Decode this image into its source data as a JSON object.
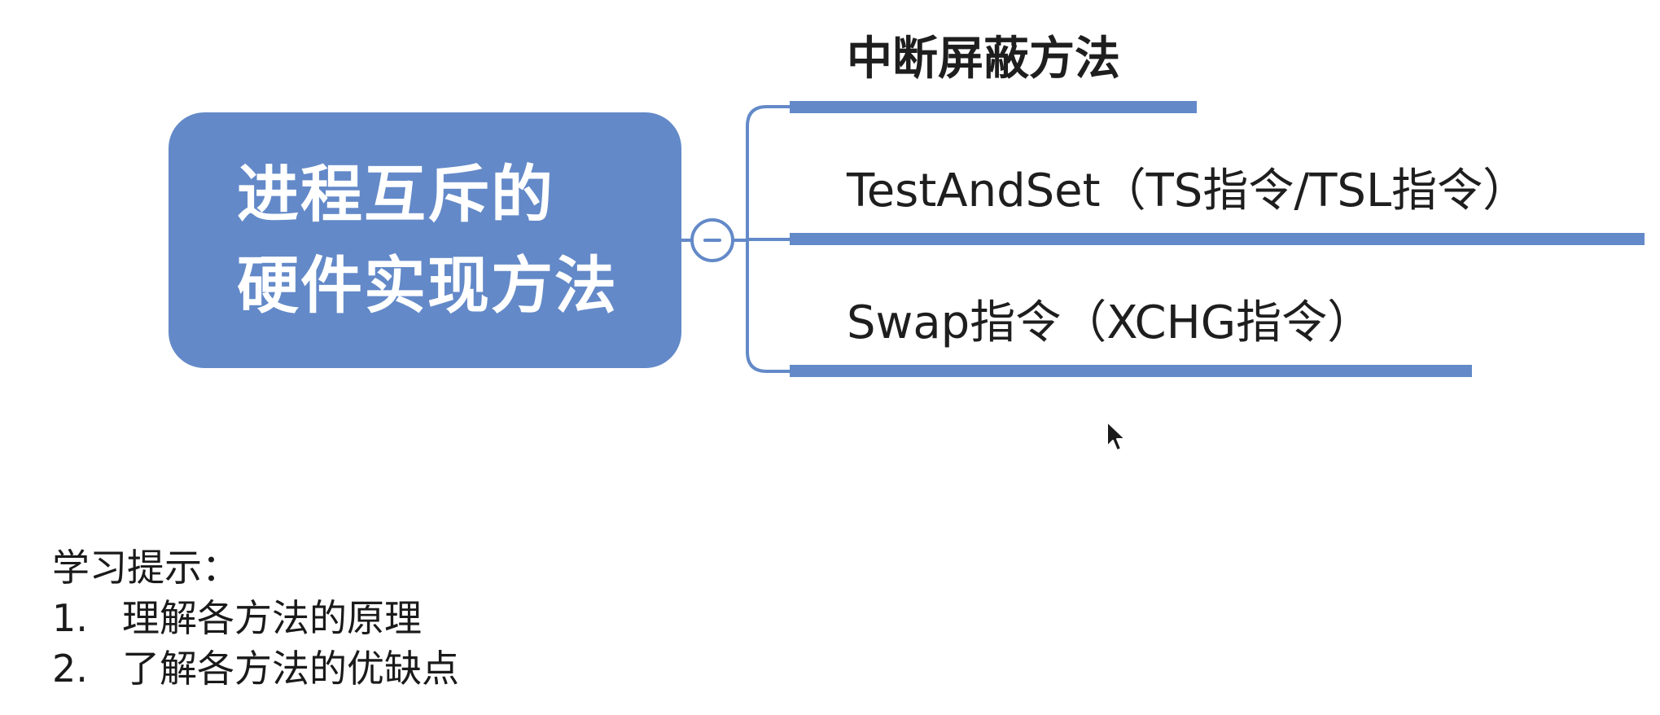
{
  "root": {
    "lines": [
      "进程互斥的",
      "硬件实现方法"
    ]
  },
  "branches": [
    {
      "label": "中断屏蔽方法"
    },
    {
      "label": "TestAndSet（TS指令/TSL指令）"
    },
    {
      "label": "Swap指令（XCHG指令）"
    }
  ],
  "toggle": {
    "icon": "collapse-minus-icon"
  },
  "tips": {
    "title": "学习提示：",
    "items": [
      {
        "num": "1.",
        "text": "理解各方法的原理"
      },
      {
        "num": "2.",
        "text": "了解各方法的优缺点"
      }
    ]
  },
  "colors": {
    "accent": "#6389c8",
    "text": "#1e1e1e",
    "background": "#ffffff"
  }
}
